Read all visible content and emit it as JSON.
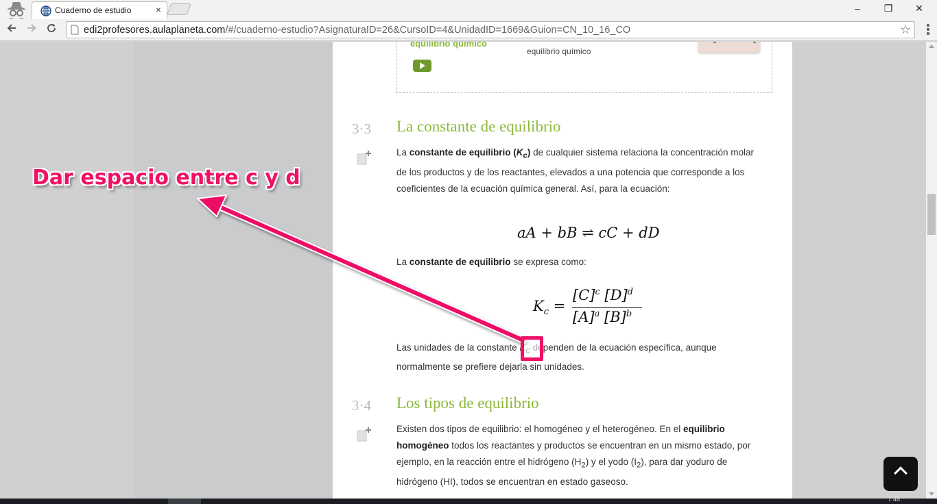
{
  "browser": {
    "tab_title": "Cuaderno de estudio",
    "tab_close": "×",
    "url_host": "edi2profesores.aulaplaneta.com",
    "url_path": "/#/cuaderno-estudio?AsignaturaID=26&CursoID=4&UnidadID=1669&Guion=CN_10_16_CO",
    "window_controls": [
      "–",
      "❐",
      "✕"
    ]
  },
  "video_card": {
    "title": "equilibrio químico",
    "description": "equilibrio químico"
  },
  "section_33": {
    "number": "3·3",
    "title": "La constante de equilibrio",
    "p1_a": "La ",
    "p1_b": "constante de equilibrio (",
    "p1_k": "K",
    "p1_sub": "c",
    "p1_close": ")",
    "p1_rest": " de cualquier sistema relaciona la concentración molar de los productos y de los reactantes, elevados a una potencia que corresponde a los coeficientes de la ecuación química general. Así, para la ecuación:",
    "equation_left": "aA + bB",
    "equation_arrow": "⇌",
    "equation_right": "cC + dD",
    "p2_a": "La ",
    "p2_b": "constante de equilibrio",
    "p2_rest": " se expresa como:",
    "kc_label": "K",
    "kc_sub": "c",
    "eq_sign": " = ",
    "num_c": "[C]",
    "num_c_exp": "c",
    "num_d": " [D]",
    "num_d_exp": "d",
    "den_a": "[A]",
    "den_a_exp": "a",
    "den_b": " [B]",
    "den_b_exp": "b",
    "p3_a": "Las unidades de la constante ",
    "p3_k": "K",
    "p3_sub": "c",
    "p3_rest": " dependen de la ecuación específica, aunque normalmente se prefiere dejarla sin unidades."
  },
  "section_34": {
    "number": "3·4",
    "title": "Los tipos de equilibrio",
    "p_a": "Existen dos tipos de equilibrio: el homogéneo y el heterogéneo. En el ",
    "p_b": "equilibrio homogéneo",
    "p_c": " todos los reactantes y productos se encuentran en un mismo estado, por ejemplo, en la reacción entre el hidrógeno (H",
    "p_sub1": "2",
    "p_d": ") y el yodo (I",
    "p_sub2": "2",
    "p_e": "), para dar yoduro de hidrógeno (HI), todos se encuentran en estado gaseoso."
  },
  "annotation": {
    "text": "Dar espacio entre c y d",
    "color": "#ee1166"
  },
  "taskbar": {
    "clock": "7:48"
  },
  "colors": {
    "accent_green": "#8cb83a",
    "annotation": "#ee1166"
  }
}
